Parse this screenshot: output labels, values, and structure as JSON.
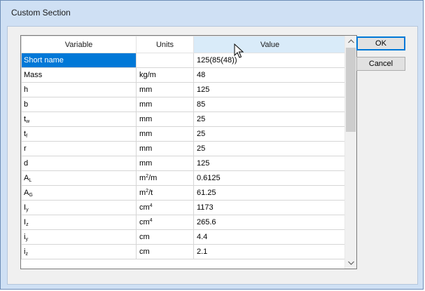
{
  "window": {
    "title": "Custom Section"
  },
  "grid": {
    "columns": [
      "Variable",
      "Units",
      "Value"
    ],
    "rows": [
      {
        "var": "Short name",
        "sub": "",
        "units": "",
        "usup": "",
        "usuf": "",
        "value": "125(85(48))"
      },
      {
        "var": "Mass",
        "sub": "",
        "units": "kg/m",
        "usup": "",
        "usuf": "",
        "value": "48"
      },
      {
        "var": "h",
        "sub": "",
        "units": "mm",
        "usup": "",
        "usuf": "",
        "value": "125"
      },
      {
        "var": "b",
        "sub": "",
        "units": "mm",
        "usup": "",
        "usuf": "",
        "value": "85"
      },
      {
        "var": "t",
        "sub": "w",
        "units": "mm",
        "usup": "",
        "usuf": "",
        "value": "25"
      },
      {
        "var": "t",
        "sub": "f",
        "units": "mm",
        "usup": "",
        "usuf": "",
        "value": "25"
      },
      {
        "var": "r",
        "sub": "",
        "units": "mm",
        "usup": "",
        "usuf": "",
        "value": "25"
      },
      {
        "var": "d",
        "sub": "",
        "units": "mm",
        "usup": "",
        "usuf": "",
        "value": "125"
      },
      {
        "var": "A",
        "sub": "L",
        "units": "m",
        "usup": "2",
        "usuf": "/m",
        "value": "0.6125"
      },
      {
        "var": "A",
        "sub": "G",
        "units": "m",
        "usup": "2",
        "usuf": "/t",
        "value": "61.25"
      },
      {
        "var": "I",
        "sub": "y",
        "units": "cm",
        "usup": "4",
        "usuf": "",
        "value": "1173"
      },
      {
        "var": "I",
        "sub": "z",
        "units": "cm",
        "usup": "4",
        "usuf": "",
        "value": "265.6"
      },
      {
        "var": "i",
        "sub": "y",
        "units": "cm",
        "usup": "",
        "usuf": "",
        "value": "4.4"
      },
      {
        "var": "i",
        "sub": "z",
        "units": "cm",
        "usup": "",
        "usuf": "",
        "value": "2.1"
      }
    ]
  },
  "buttons": {
    "ok": "OK",
    "cancel": "Cancel"
  },
  "icons": {
    "cursor": "mouse-pointer-icon",
    "scroll_up": "chevron-up-icon",
    "scroll_down": "chevron-down-icon"
  },
  "colors": {
    "selection": "#0078d7",
    "window_frame": "#cfe0f4",
    "value_header": "#d9ebf9"
  }
}
